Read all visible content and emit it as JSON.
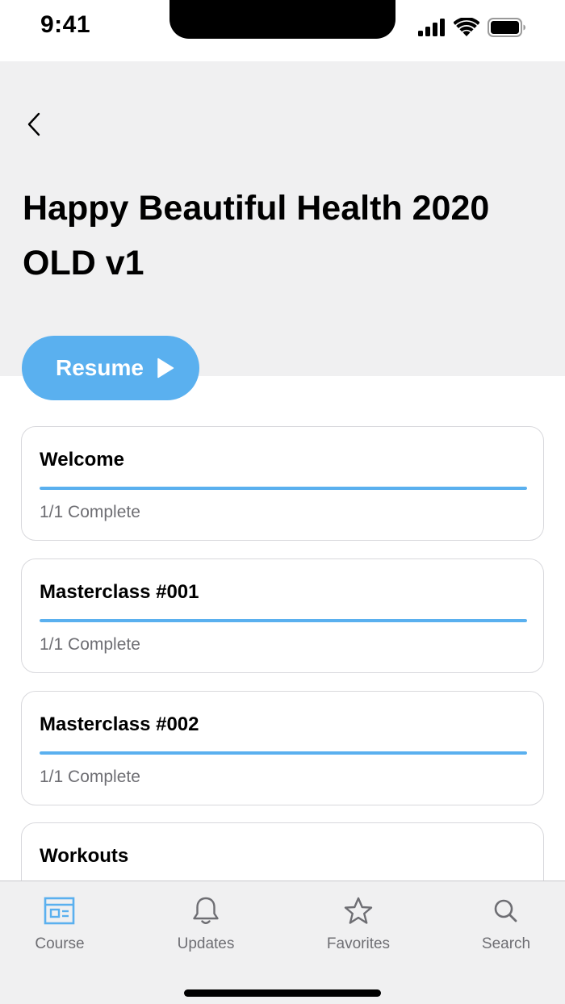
{
  "status_bar": {
    "time": "9:41",
    "icons": [
      "cellular-signal-icon",
      "wifi-icon",
      "battery-icon"
    ]
  },
  "header": {
    "back_icon": "chevron-left-icon",
    "title": "Happy Beautiful Health 2020 OLD v1"
  },
  "resume_button": {
    "label": "Resume",
    "icon": "play-icon"
  },
  "modules": [
    {
      "title": "Welcome",
      "status": "1/1 Complete",
      "progress": 1.0
    },
    {
      "title": "Masterclass #001",
      "status": "1/1 Complete",
      "progress": 1.0
    },
    {
      "title": "Masterclass #002",
      "status": "1/1 Complete",
      "progress": 1.0
    },
    {
      "title": "Workouts",
      "status": "",
      "progress": null
    }
  ],
  "tab_bar": {
    "tabs": [
      {
        "label": "Course",
        "icon": "course-icon",
        "active": true
      },
      {
        "label": "Updates",
        "icon": "bell-icon",
        "active": false
      },
      {
        "label": "Favorites",
        "icon": "star-icon",
        "active": false
      },
      {
        "label": "Search",
        "icon": "search-icon",
        "active": false
      }
    ]
  },
  "colors": {
    "accent": "#5ab0ef",
    "header_bg": "#f0f0f1",
    "muted_text": "#6e6e73",
    "card_border": "#d8d8dc"
  }
}
